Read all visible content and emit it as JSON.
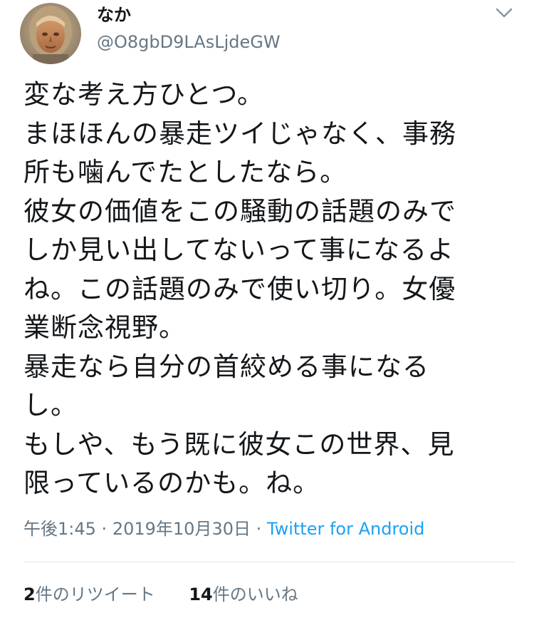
{
  "user": {
    "display_name": "なか",
    "handle": "@O8gbD9LAsLjdeGW",
    "avatar_icon": "profile-photo-face-icon"
  },
  "header": {
    "menu_icon": "chevron-down-icon",
    "menu_icon_color": "#8899a6"
  },
  "tweet": {
    "lines": [
      "変な考え方ひとつ。",
      "まほほんの暴走ツイじゃなく、事務",
      "所も噛んでたとしたなら。",
      "彼女の価値をこの騒動の話題のみで",
      "しか見い出してないって事になるよ",
      "ね。この話題のみで使い切り。女優",
      "業断念視野。",
      "暴走なら自分の首絞める事になる",
      "し。",
      "もしや、もう既に彼女この世界、見",
      "限っているのかも。ね。"
    ]
  },
  "meta": {
    "time": "午後1:45",
    "separator": "·",
    "date": "2019年10月30日",
    "source": "Twitter for Android"
  },
  "stats": {
    "retweets_count": "2",
    "retweets_label": "件のリツイート",
    "likes_count": "14",
    "likes_label": "件のいいね"
  },
  "colors": {
    "text": "#14171a",
    "secondary": "#657786",
    "link": "#1da1f2",
    "divider": "#e1e8ed"
  }
}
